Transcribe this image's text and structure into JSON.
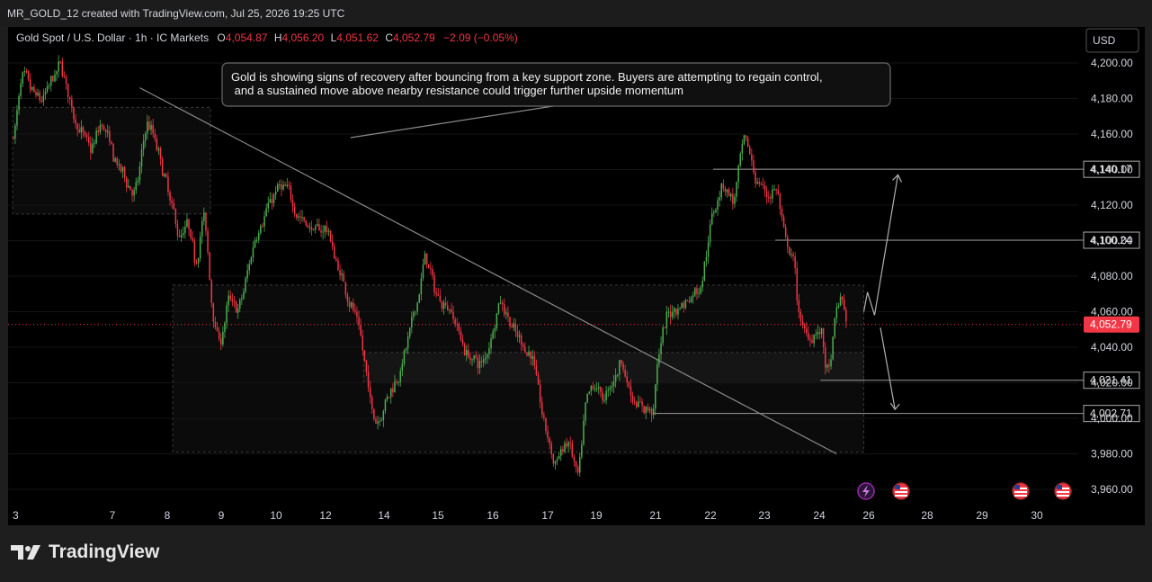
{
  "header": {
    "created_by": "MR_GOLD_12 created with TradingView.com, Jul 25, 2026 19:25 UTC",
    "symbol": "Gold Spot / U.S. Dollar · 1h · IC Markets",
    "ohlc": {
      "o_label": "O",
      "o": "4,054.87",
      "h_label": "H",
      "h": "4,056.20",
      "l_label": "L",
      "l": "4,051.62",
      "c_label": "C",
      "c": "4,052.79",
      "change": "−2.09 (−0.05%)"
    }
  },
  "currency_button": "USD",
  "annotation": {
    "line1": "Gold is showing signs of recovery after bouncing from a key support zone. Buyers are attempting to regain control,",
    "line2": " and a sustained move above nearby resistance could trigger further upside momentum"
  },
  "colors": {
    "up": "#4caf50",
    "down": "#f23645",
    "background": "#000000",
    "price_badge": "#f23645"
  },
  "footer": {
    "brand": "TradingView",
    "brand_icon": "tradingview-logo-icon"
  },
  "event_icons": [
    "lightning-event-icon",
    "us-flag-event-icon",
    "us-flag-event-icon",
    "us-flag-event-icon"
  ],
  "chart_data": {
    "type": "candlestick",
    "symbol": "Gold Spot / U.S. Dollar",
    "timeframe": "1h",
    "ylim": [
      3955,
      4208
    ],
    "y_ticks": [
      3960,
      3980,
      4000,
      4020,
      4040,
      4060,
      4080,
      4100,
      4120,
      4140,
      4160,
      4180,
      4200
    ],
    "y_tick_labels": [
      "3,960.00",
      "3,980.00",
      "4,000.00",
      "4,020.00",
      "4,040.00",
      "4,060.00",
      "4,080.00",
      "4,100.00",
      "4,120.00",
      "4,140.00",
      "4,160.00",
      "4,180.00",
      "4,200.00"
    ],
    "x_tick_labels": [
      "3",
      "7",
      "8",
      "9",
      "10",
      "12",
      "14",
      "15",
      "16",
      "17",
      "19",
      "21",
      "22",
      "23",
      "24",
      "26",
      "28",
      "29",
      "30"
    ],
    "x_tick_days": [
      3,
      7,
      8,
      9,
      10,
      12,
      14,
      15,
      16,
      17,
      19,
      21,
      22,
      23,
      24,
      26,
      28,
      29,
      30
    ],
    "current_price": 4052.79,
    "current_price_label": "4,052.79",
    "levels": [
      {
        "value": 4140.17,
        "label": "4,140.17"
      },
      {
        "value": 4100.24,
        "label": "4,100.24"
      },
      {
        "value": 4021.41,
        "label": "4,021.41"
      },
      {
        "value": 4002.71,
        "label": "4,002.71"
      }
    ],
    "trendline": {
      "from": {
        "day": 7.5,
        "price": 4186
      },
      "to": {
        "day": 24.7,
        "price": 3980
      }
    },
    "zones": [
      {
        "day_from": 3,
        "day_to": 8.8,
        "price_from": 4115,
        "price_to": 4175
      },
      {
        "day_from": 8.1,
        "day_to": 25.8,
        "price_from": 3981,
        "price_to": 4075
      },
      {
        "day_from": 13.3,
        "day_to": 25.8,
        "price_from": 4020,
        "price_to": 4037
      }
    ],
    "projection": {
      "up_path": [
        {
          "day": 25.8,
          "price": 4060
        },
        {
          "day": 25.95,
          "price": 4071
        },
        {
          "day": 26.2,
          "price": 4058
        },
        {
          "day": 27.0,
          "price": 4137
        }
      ],
      "down_path": [
        {
          "day": 26.4,
          "price": 4051
        },
        {
          "day": 26.9,
          "price": 4005
        }
      ]
    },
    "series": [
      {
        "day": 3.0,
        "price": 4158
      },
      {
        "day": 3.3,
        "price": 4195
      },
      {
        "day": 3.7,
        "price": 4183
      },
      {
        "day": 4.1,
        "price": 4178
      },
      {
        "day": 4.5,
        "price": 4190
      },
      {
        "day": 4.9,
        "price": 4200
      },
      {
        "day": 5.3,
        "price": 4172
      },
      {
        "day": 5.7,
        "price": 4160
      },
      {
        "day": 6.1,
        "price": 4150
      },
      {
        "day": 6.5,
        "price": 4168
      },
      {
        "day": 6.8,
        "price": 4155
      },
      {
        "day": 7.1,
        "price": 4140
      },
      {
        "day": 7.4,
        "price": 4125
      },
      {
        "day": 7.6,
        "price": 4170
      },
      {
        "day": 7.8,
        "price": 4150
      },
      {
        "day": 8.0,
        "price": 4125
      },
      {
        "day": 8.2,
        "price": 4100
      },
      {
        "day": 8.35,
        "price": 4110
      },
      {
        "day": 8.5,
        "price": 4085
      },
      {
        "day": 8.65,
        "price": 4120
      },
      {
        "day": 8.8,
        "price": 4060
      },
      {
        "day": 8.95,
        "price": 4040
      },
      {
        "day": 9.1,
        "price": 4068
      },
      {
        "day": 9.3,
        "price": 4060
      },
      {
        "day": 9.6,
        "price": 4105
      },
      {
        "day": 10.0,
        "price": 4130
      },
      {
        "day": 10.4,
        "price": 4128
      },
      {
        "day": 10.8,
        "price": 4115
      },
      {
        "day": 11.2,
        "price": 4108
      },
      {
        "day": 11.6,
        "price": 4105
      },
      {
        "day": 12.0,
        "price": 4108
      },
      {
        "day": 12.3,
        "price": 4087
      },
      {
        "day": 12.7,
        "price": 4070
      },
      {
        "day": 13.1,
        "price": 4050
      },
      {
        "day": 13.5,
        "price": 4005
      },
      {
        "day": 13.7,
        "price": 3998
      },
      {
        "day": 14.0,
        "price": 4010
      },
      {
        "day": 14.3,
        "price": 4030
      },
      {
        "day": 14.6,
        "price": 4068
      },
      {
        "day": 14.75,
        "price": 4095
      },
      {
        "day": 14.9,
        "price": 4070
      },
      {
        "day": 15.2,
        "price": 4062
      },
      {
        "day": 15.5,
        "price": 4035
      },
      {
        "day": 15.8,
        "price": 4030
      },
      {
        "day": 16.1,
        "price": 4068
      },
      {
        "day": 16.4,
        "price": 4045
      },
      {
        "day": 16.7,
        "price": 4035
      },
      {
        "day": 16.9,
        "price": 3995
      },
      {
        "day": 17.2,
        "price": 3972
      },
      {
        "day": 17.5,
        "price": 3982
      },
      {
        "day": 17.8,
        "price": 3988
      },
      {
        "day": 18.0,
        "price": 3975
      },
      {
        "day": 18.2,
        "price": 3962
      },
      {
        "day": 18.5,
        "price": 4010
      },
      {
        "day": 18.9,
        "price": 4020
      },
      {
        "day": 19.2,
        "price": 4010
      },
      {
        "day": 19.5,
        "price": 4020
      },
      {
        "day": 19.8,
        "price": 4035
      },
      {
        "day": 20.1,
        "price": 4012
      },
      {
        "day": 20.5,
        "price": 4005
      },
      {
        "day": 20.9,
        "price": 4005
      },
      {
        "day": 21.0,
        "price": 4035
      },
      {
        "day": 21.2,
        "price": 4060
      },
      {
        "day": 21.5,
        "price": 4065
      },
      {
        "day": 21.8,
        "price": 4075
      },
      {
        "day": 22.0,
        "price": 4115
      },
      {
        "day": 22.2,
        "price": 4135
      },
      {
        "day": 22.4,
        "price": 4120
      },
      {
        "day": 22.6,
        "price": 4160
      },
      {
        "day": 22.8,
        "price": 4135
      },
      {
        "day": 23.0,
        "price": 4125
      },
      {
        "day": 23.2,
        "price": 4130
      },
      {
        "day": 23.35,
        "price": 4095
      },
      {
        "day": 23.5,
        "price": 4090
      },
      {
        "day": 23.6,
        "price": 4055
      },
      {
        "day": 23.75,
        "price": 4045
      },
      {
        "day": 23.9,
        "price": 4050
      },
      {
        "day": 24.05,
        "price": 4048
      },
      {
        "day": 24.2,
        "price": 4025
      },
      {
        "day": 24.35,
        "price": 4024
      },
      {
        "day": 24.5,
        "price": 4045
      },
      {
        "day": 24.65,
        "price": 4063
      },
      {
        "day": 24.8,
        "price": 4070
      },
      {
        "day": 24.9,
        "price": 4065
      },
      {
        "day": 25.0,
        "price": 4056
      },
      {
        "day": 25.1,
        "price": 4053
      }
    ]
  }
}
